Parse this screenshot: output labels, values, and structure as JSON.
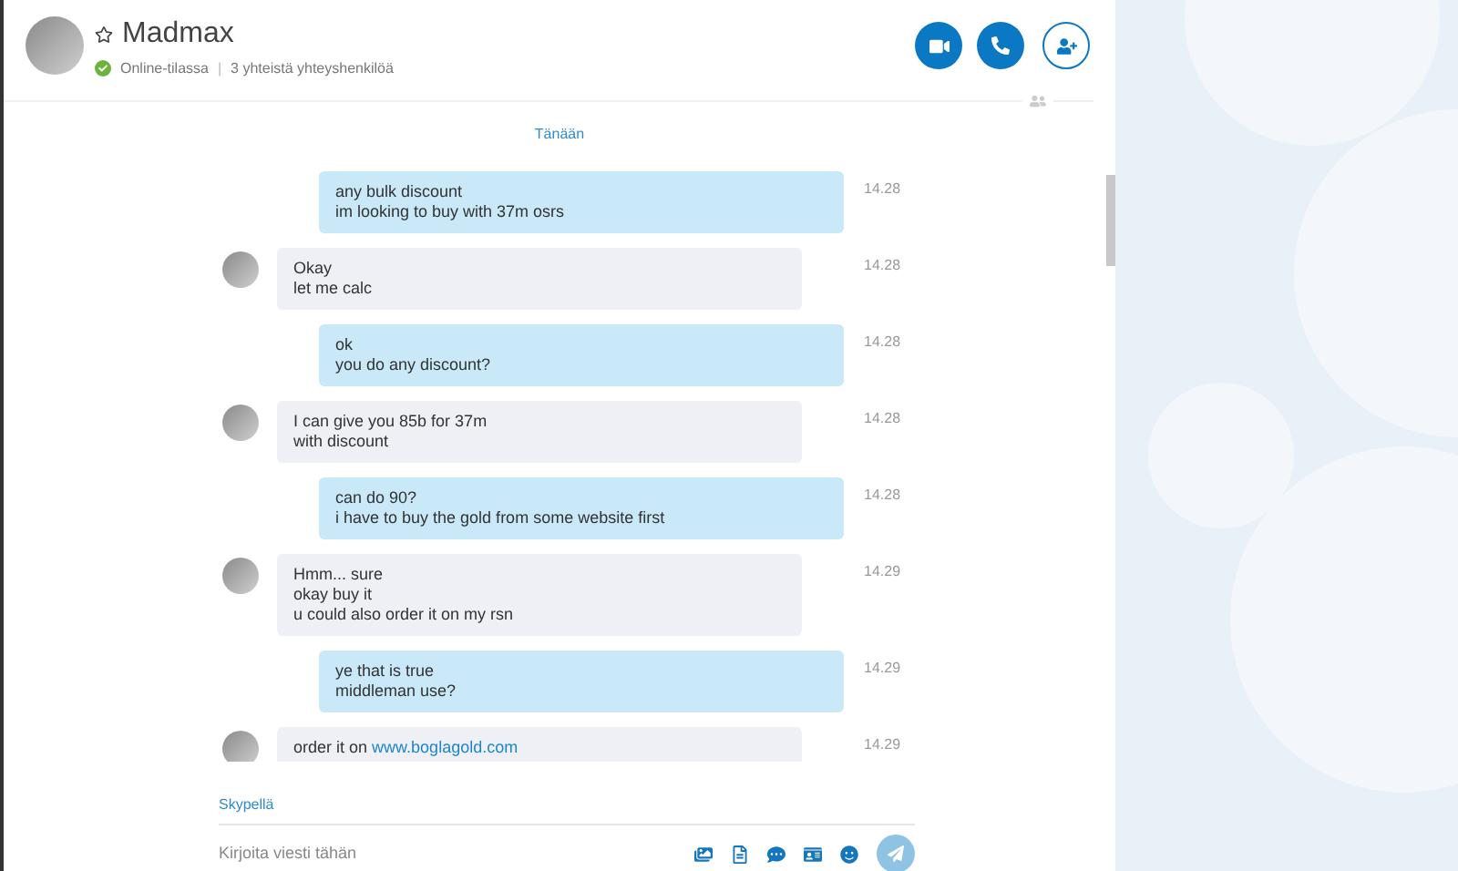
{
  "contact": {
    "name": "Madmax",
    "favorite": false,
    "status": "Online-tilassa",
    "separator": "|",
    "mutual": "3 yhteistä yhteyshenkilöä"
  },
  "date_label": "Tänään",
  "messages": [
    {
      "kind": "sent",
      "lines": [
        "any bulk discount",
        "im looking to buy with 37m osrs"
      ],
      "time": "14.28"
    },
    {
      "kind": "received",
      "lines": [
        "Okay",
        "let me calc"
      ],
      "time": "14.28"
    },
    {
      "kind": "sent",
      "lines": [
        "ok",
        "you do any discount?"
      ],
      "time": "14.28"
    },
    {
      "kind": "received",
      "lines": [
        "I can give you 85b for 37m",
        "with discount"
      ],
      "time": "14.28"
    },
    {
      "kind": "sent",
      "lines": [
        "can do 90?",
        "i have to buy the gold from some website first"
      ],
      "time": "14.28"
    },
    {
      "kind": "received",
      "lines": [
        "Hmm... sure",
        "okay buy it",
        "u could also order it on my rsn"
      ],
      "time": "14.29"
    },
    {
      "kind": "sent",
      "lines": [
        "ye that is true",
        "middleman use?"
      ],
      "time": "14.29"
    },
    {
      "kind": "received",
      "lines": [
        "order it on"
      ],
      "link": "www.boglagold.com",
      "time": "14.29",
      "cut": true
    }
  ],
  "footer": {
    "skype_link": "Skypellä",
    "input": {
      "placeholder": "Kirjoita viesti tähän"
    }
  }
}
